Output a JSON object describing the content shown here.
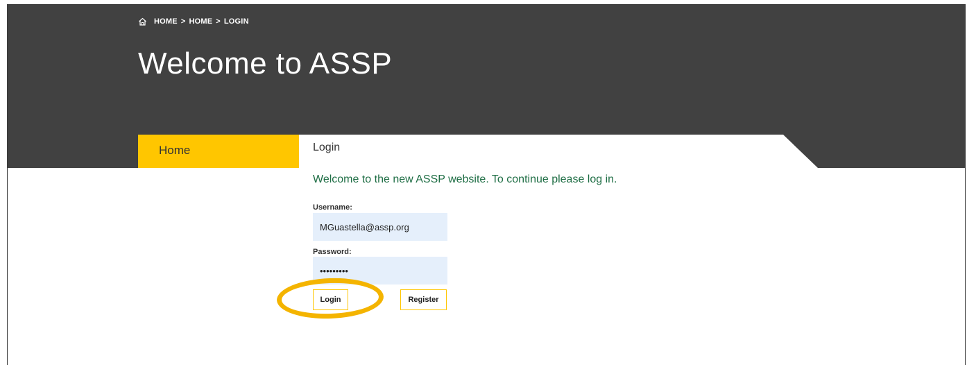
{
  "breadcrumb": {
    "icon": "home-icon",
    "items": [
      "HOME",
      "HOME",
      "LOGIN"
    ],
    "separator": ">"
  },
  "site": {
    "title": "Welcome to ASSP"
  },
  "nav": {
    "home_label": "Home"
  },
  "login": {
    "heading": "Login",
    "welcome": "Welcome to the new ASSP website. To continue please log in.",
    "username_label": "Username:",
    "username_value": "MGuastella@assp.org",
    "password_label": "Password:",
    "password_value": "123456789",
    "login_button": "Login",
    "register_button": "Register"
  },
  "colors": {
    "header_bg": "#414141",
    "accent": "#ffc600",
    "welcome_text": "#1f6e45",
    "input_bg": "#e5effb",
    "highlight": "#f4b400"
  }
}
